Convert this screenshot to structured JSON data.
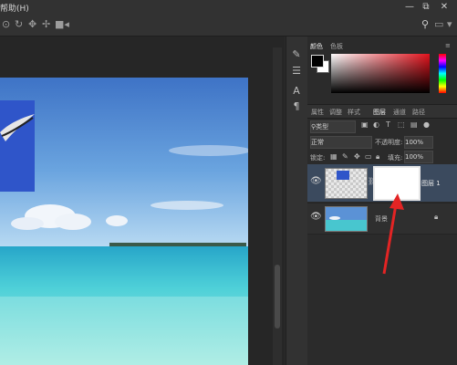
{
  "menubar": {
    "help_label": "帮助(H)"
  },
  "window_controls": [
    "—",
    "⧉",
    "✕"
  ],
  "options_bar": {
    "icons": [
      "rotate-3d-icon",
      "roll-icon",
      "drag-icon",
      "slide-icon",
      "scale-icon"
    ],
    "right_icons": [
      "search-icon",
      "workspace-icon",
      "share-icon"
    ]
  },
  "color_panel": {
    "tabs": [
      "颜色",
      "色板"
    ],
    "fg_color": "#000000",
    "bg_color": "#ffffff"
  },
  "layers_panel": {
    "tabs": [
      "属性",
      "调整",
      "样式",
      "图层",
      "通道",
      "路径"
    ],
    "active_tab": "图层",
    "filter_label": "类型",
    "blend_mode": "正常",
    "opacity_label": "不透明度:",
    "opacity_value": "100%",
    "lock_label": "锁定:",
    "fill_label": "填充:",
    "fill_value": "100%",
    "layers": [
      {
        "name": "图层 1",
        "has_mask": true,
        "selected": true
      },
      {
        "name": "背景",
        "locked": true
      }
    ]
  },
  "colors": {
    "accent_selected_layer": "#3b4a5e",
    "annotation_arrow": "#e32424"
  }
}
